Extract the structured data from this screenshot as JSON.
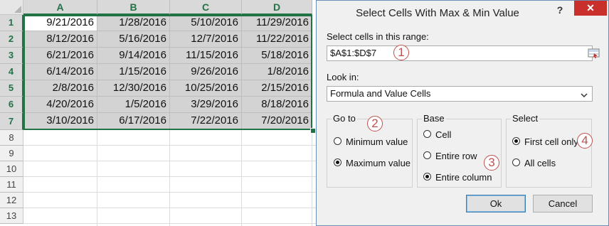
{
  "sheet": {
    "columns": [
      "A",
      "B",
      "C",
      "D"
    ],
    "rows": [
      "1",
      "2",
      "3",
      "4",
      "5",
      "6",
      "7",
      "8",
      "9",
      "10",
      "11",
      "12",
      "13"
    ],
    "data": [
      [
        "9/21/2016",
        "1/28/2016",
        "5/10/2016",
        "11/29/2016"
      ],
      [
        "8/12/2016",
        "5/16/2016",
        "12/7/2016",
        "11/22/2016"
      ],
      [
        "6/21/2016",
        "9/14/2016",
        "11/15/2016",
        "5/18/2016"
      ],
      [
        "6/14/2016",
        "1/15/2016",
        "9/26/2016",
        "1/8/2016"
      ],
      [
        "2/8/2016",
        "12/30/2016",
        "10/25/2016",
        "2/15/2016"
      ],
      [
        "4/20/2016",
        "1/5/2016",
        "3/29/2016",
        "8/18/2016"
      ],
      [
        "3/10/2016",
        "6/17/2016",
        "7/22/2016",
        "7/20/2016"
      ]
    ],
    "selection_color": "#217346"
  },
  "dialog": {
    "title": "Select Cells With Max & Min Value",
    "help": "?",
    "close": "✕",
    "range_label": "Select cells in this range:",
    "range_value": "$A$1:$D$7",
    "lookin_label": "Look in:",
    "lookin_value": "Formula and Value Cells",
    "goto": {
      "title": "Go to",
      "options": [
        "Minimum value",
        "Maximum value"
      ],
      "selected": "Maximum value"
    },
    "base": {
      "title": "Base",
      "options": [
        "Cell",
        "Entire row",
        "Entire column"
      ],
      "selected": "Entire column"
    },
    "select": {
      "title": "Select",
      "options": [
        "First cell only",
        "All cells"
      ],
      "selected": "First cell only"
    },
    "ok": "Ok",
    "cancel": "Cancel",
    "close_color": "#c9302c"
  },
  "annotations": [
    "1",
    "2",
    "3",
    "4"
  ],
  "annotation_color": "#c0504d"
}
